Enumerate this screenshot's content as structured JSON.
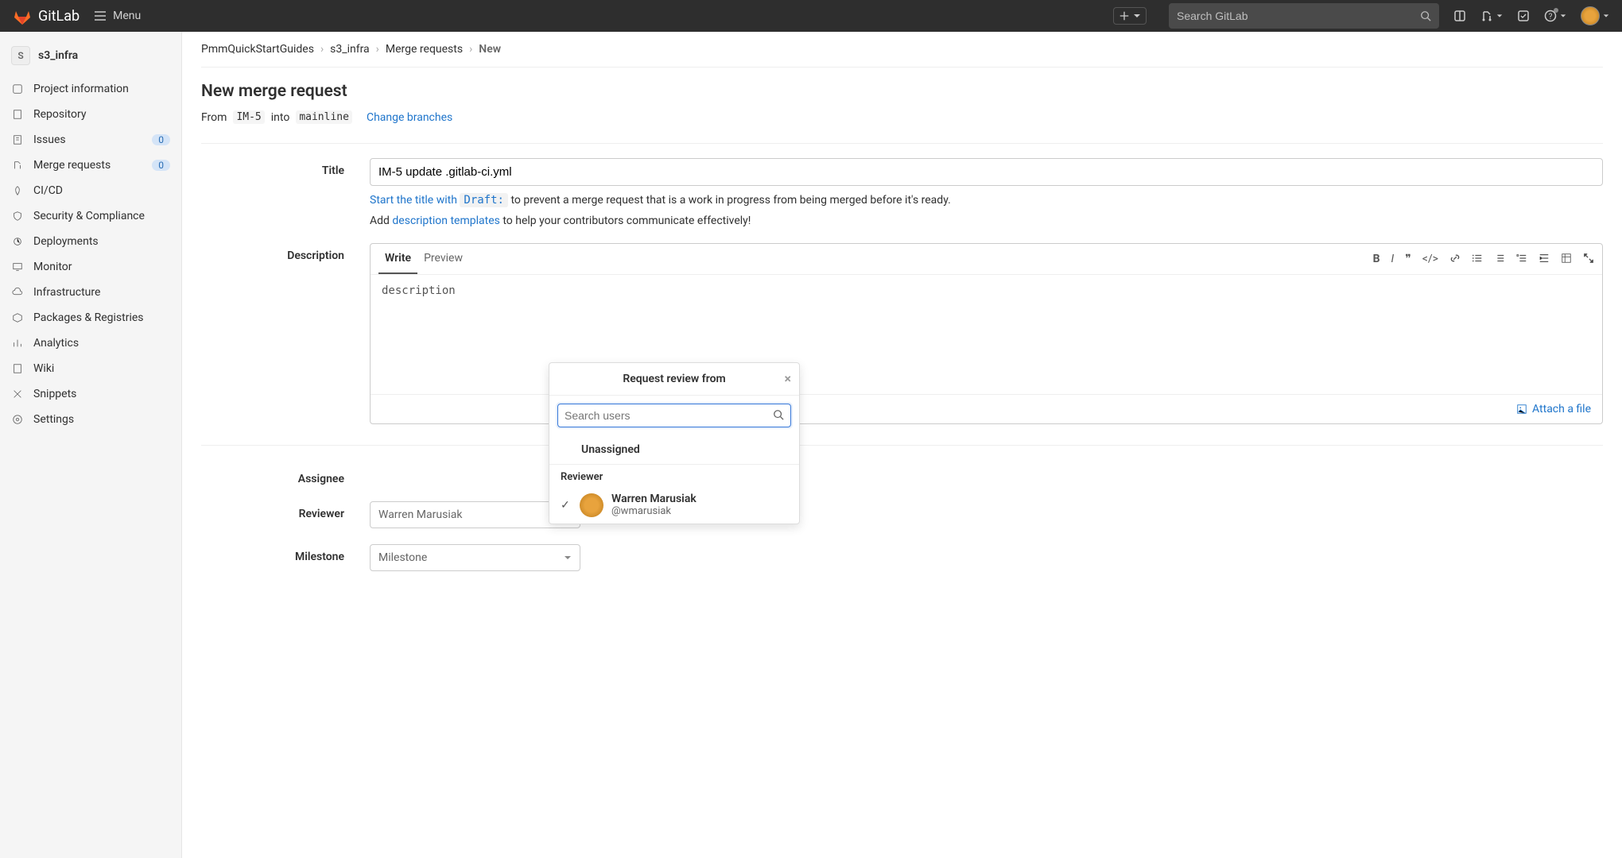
{
  "topbar": {
    "brand": "GitLab",
    "menu_label": "Menu",
    "search_placeholder": "Search GitLab"
  },
  "sidebar": {
    "project_avatar_letter": "S",
    "project_name": "s3_infra",
    "items": [
      {
        "label": "Project information"
      },
      {
        "label": "Repository"
      },
      {
        "label": "Issues",
        "badge": "0"
      },
      {
        "label": "Merge requests",
        "badge": "0"
      },
      {
        "label": "CI/CD"
      },
      {
        "label": "Security & Compliance"
      },
      {
        "label": "Deployments"
      },
      {
        "label": "Monitor"
      },
      {
        "label": "Infrastructure"
      },
      {
        "label": "Packages & Registries"
      },
      {
        "label": "Analytics"
      },
      {
        "label": "Wiki"
      },
      {
        "label": "Snippets"
      },
      {
        "label": "Settings"
      }
    ]
  },
  "breadcrumb": {
    "a": "PmmQuickStartGuides",
    "b": "s3_infra",
    "c": "Merge requests",
    "d": "New"
  },
  "page": {
    "title": "New merge request",
    "from_word": "From",
    "from_branch": "IM-5",
    "into_word": "into",
    "to_branch": "mainline",
    "change_branches": "Change branches"
  },
  "form": {
    "title_label": "Title",
    "title_value": "IM-5 update .gitlab-ci.yml",
    "draft_hint_pre": "Start the title with ",
    "draft_tag": "Draft:",
    "draft_hint_post": " to prevent a merge request that is a work in progress from being merged before it's ready.",
    "tmpl_hint_pre": "Add ",
    "tmpl_link": "description templates",
    "tmpl_hint_post": " to help your contributors communicate effectively!",
    "description_label": "Description",
    "write_tab": "Write",
    "preview_tab": "Preview",
    "description_value": "description",
    "attach_label": "Attach a file",
    "assignee_label": "Assignee",
    "reviewer_label": "Reviewer",
    "reviewer_value": "Warren Marusiak",
    "milestone_label": "Milestone",
    "milestone_value": "Milestone"
  },
  "popover": {
    "title": "Request review from",
    "search_placeholder": "Search users",
    "unassigned": "Unassigned",
    "section": "Reviewer",
    "user_name": "Warren Marusiak",
    "user_handle": "@wmarusiak"
  }
}
